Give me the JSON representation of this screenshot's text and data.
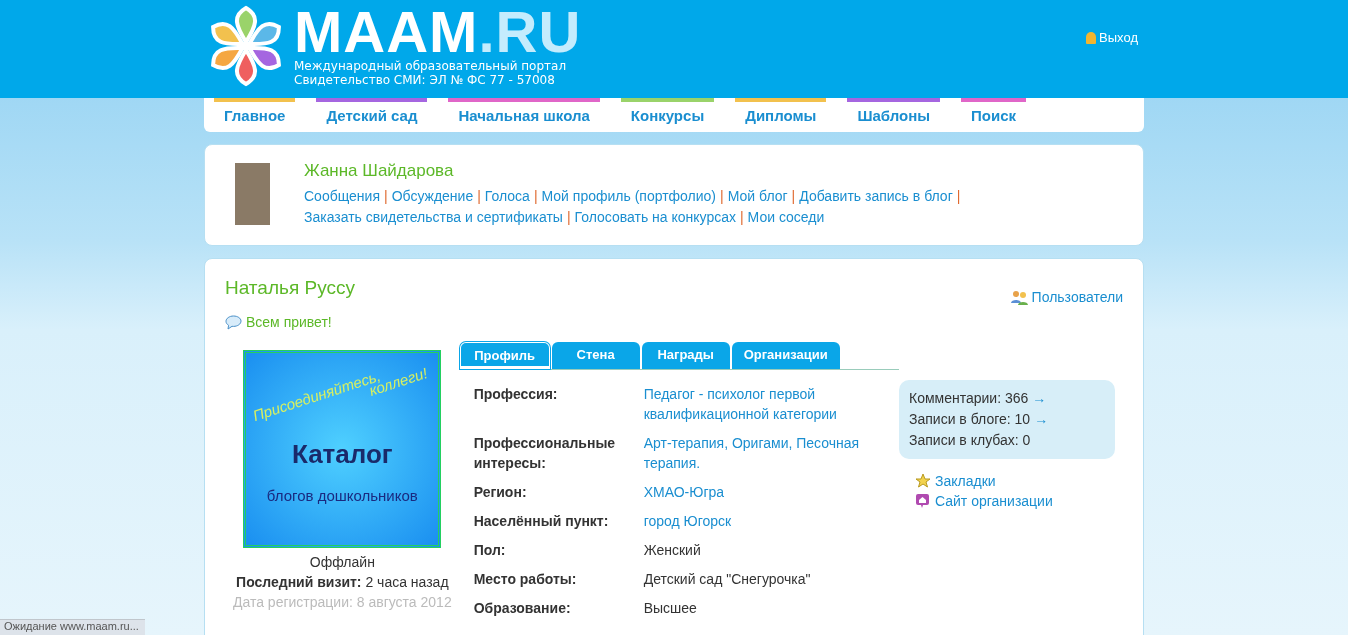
{
  "header": {
    "logo_text": "MAAM",
    "logo_domain": ".RU",
    "subtitle_1": "Международный образовательный портал",
    "subtitle_2": "Свидетельство СМИ: ЭЛ № ФС 77 - 57008",
    "logout": "Выход"
  },
  "nav": [
    {
      "label": "Главное",
      "color": "#f2c14e"
    },
    {
      "label": "Детский сад",
      "color": "#a566e0"
    },
    {
      "label": "Начальная школа",
      "color": "#e066c8"
    },
    {
      "label": "Конкурсы",
      "color": "#9ad36a"
    },
    {
      "label": "Дипломы",
      "color": "#f2c14e"
    },
    {
      "label": "Шаблоны",
      "color": "#a566e0"
    },
    {
      "label": "Поиск",
      "color": "#e066c8"
    }
  ],
  "user_panel": {
    "name": "Жанна Шайдарова",
    "separator": "|",
    "links": [
      "Сообщения",
      "Обсуждение",
      "Голоса",
      "Мой профиль (портфолио)",
      "Мой блог",
      "Добавить запись в блог",
      "Заказать свидетельства и сертификаты",
      "Голосовать на конкурсах",
      "Мои соседи"
    ]
  },
  "profile": {
    "name": "Наталья Руссу",
    "users_link": "Пользователи",
    "status": "Всем привет!",
    "banner": {
      "line_1": "Присоединяйтесь,",
      "line_2": "коллеги!",
      "title": "Каталог",
      "subtitle": "блогов дошкольников"
    },
    "online_status": "Оффлайн",
    "last_visit": "**Последний визит:** 2 часа назад",
    "registered": "Дата регистрации: 8 августа 2012",
    "tabs": [
      {
        "label": "Профиль",
        "selected": true
      },
      {
        "label": "Стена",
        "selected": false
      },
      {
        "label": "Награды",
        "selected": false
      },
      {
        "label": "Организации",
        "selected": false
      }
    ],
    "fields": [
      {
        "label": "Профессия:",
        "value": "Педагог - психолог первой квалификационной категории",
        "link": true
      },
      {
        "label": "Профессиональные интересы:",
        "value": "Арт-терапия, Оригами, Песочная терапия.",
        "link": true
      },
      {
        "label": "Регион:",
        "value": "ХМАО-Югра",
        "link": true
      },
      {
        "label": "Населённый пункт:",
        "value": "город Югорск",
        "link": true
      },
      {
        "label": "Пол:",
        "value": "Женский",
        "link": false
      },
      {
        "label": "Место работы:",
        "value": "Детский сад \"Снегурочка\"",
        "link": false
      },
      {
        "label": "Образование:",
        "value": "Высшее",
        "link": false
      }
    ],
    "stats": [
      {
        "label": "Комментарии: 366",
        "arrow": "→"
      },
      {
        "label": "Записи в блоге: 10",
        "arrow": "→"
      },
      {
        "label": "Записи в клубах: 0"
      }
    ],
    "side_links": [
      {
        "label": "Закладки",
        "kind": "star"
      },
      {
        "label": "Сайт организации",
        "kind": "site"
      }
    ]
  },
  "status_bar": "Ожидание www.maam.ru..."
}
